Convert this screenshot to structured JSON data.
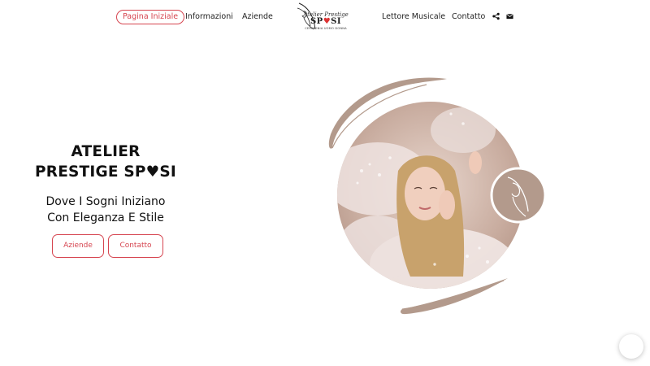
{
  "nav": {
    "items": [
      {
        "label": "Pagina Iniziale",
        "active": true
      },
      {
        "label": "Informazioni",
        "active": false
      },
      {
        "label": "Aziende",
        "active": false
      },
      {
        "label": "Lettore Musicale",
        "active": false
      },
      {
        "label": "Contatto",
        "active": false
      }
    ],
    "icons": [
      "share-icon",
      "envelope-icon"
    ]
  },
  "logo": {
    "line1": "Atelier Prestige",
    "line2_pre": "SP",
    "line2_post": "SI",
    "tagline": "CERIMONIA UOMO DONNA"
  },
  "hero": {
    "title_line1": "ATELIER",
    "title_line2_pre": "PRESTIGE SP",
    "title_line2_post": "SI",
    "subtitle_line1": "Dove I Sogni Iniziano",
    "subtitle_line2": "Con Eleganza E Stile",
    "buttons": [
      {
        "label": "Aziende"
      },
      {
        "label": "Contatto"
      }
    ]
  },
  "colors": {
    "accent": "#d64550",
    "taupe": "#b39a8c",
    "text": "#111111"
  }
}
